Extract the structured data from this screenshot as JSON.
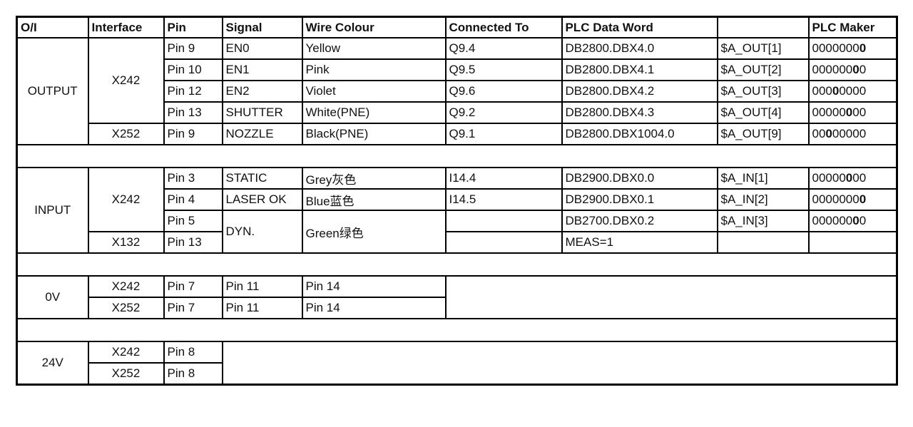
{
  "headers": [
    "O/I",
    "Interface",
    "Pin",
    "Signal",
    "Wire Colour",
    "Connected To",
    "PLC Data Word",
    "",
    "PLC Maker"
  ],
  "output": {
    "label": "OUTPUT",
    "interfaces": [
      "X242",
      "X252"
    ],
    "rows": [
      {
        "pin": "Pin 9",
        "signal": "EN0",
        "wire": "Yellow",
        "conn": "Q9.4",
        "db": "DB2800.DBX4.0",
        "var": "$A_OUT[1]",
        "maker": "00000000",
        "bold_index": 7
      },
      {
        "pin": "Pin 10",
        "signal": "EN1",
        "wire": "Pink",
        "conn": "Q9.5",
        "db": "DB2800.DBX4.1",
        "var": "$A_OUT[2]",
        "maker": "00000000",
        "bold_index": 6
      },
      {
        "pin": "Pin 12",
        "signal": "EN2",
        "wire": "Violet",
        "conn": "Q9.6",
        "db": "DB2800.DBX4.2",
        "var": "$A_OUT[3]",
        "maker": "00000000",
        "bold_index": 3
      },
      {
        "pin": "Pin 13",
        "signal": "SHUTTER",
        "wire": "White(PNE)",
        "conn": "Q9.2",
        "db": "DB2800.DBX4.3",
        "var": "$A_OUT[4]",
        "maker": "00000000",
        "bold_index": 5
      },
      {
        "pin": "Pin 9",
        "signal": "NOZZLE",
        "wire": "Black(PNE)",
        "conn": "Q9.1",
        "db": "DB2800.DBX1004.0",
        "var": "$A_OUT[9]",
        "maker": "00000000",
        "bold_index": 2
      }
    ]
  },
  "input": {
    "label": "INPUT",
    "interfaces": [
      "X242",
      "X132"
    ],
    "rows": [
      {
        "pin": "Pin 3",
        "signal": "STATIC",
        "wire": "Grey灰色",
        "conn": "I14.4",
        "db": "DB2900.DBX0.0",
        "var": "$A_IN[1]",
        "maker": "00000000",
        "bold_index": 5
      },
      {
        "pin": "Pin 4",
        "signal": "LASER OK",
        "wire": "Blue蓝色",
        "conn": "I14.5",
        "db": "DB2900.DBX0.1",
        "var": "$A_IN[2]",
        "maker": "00000000",
        "bold_index": 7
      },
      {
        "pin": "Pin 5",
        "signal": "DYN.",
        "wire": "Green绿色",
        "conn": "",
        "db": "DB2700.DBX0.2",
        "var": "$A_IN[3]",
        "maker": "00000000",
        "bold_index": 6
      },
      {
        "pin": "Pin 13",
        "conn": "",
        "db": "MEAS=1",
        "var": "",
        "maker": ""
      }
    ]
  },
  "zero_v": {
    "label": "0V",
    "rows": [
      {
        "interface": "X242",
        "a": "Pin 7",
        "b": "Pin 11",
        "c": "Pin 14"
      },
      {
        "interface": "X252",
        "a": "Pin 7",
        "b": "Pin 11",
        "c": "Pin 14"
      }
    ]
  },
  "v24": {
    "label": "24V",
    "rows": [
      {
        "interface": "X242",
        "a": "Pin 8"
      },
      {
        "interface": "X252",
        "a": "Pin 8"
      }
    ]
  }
}
